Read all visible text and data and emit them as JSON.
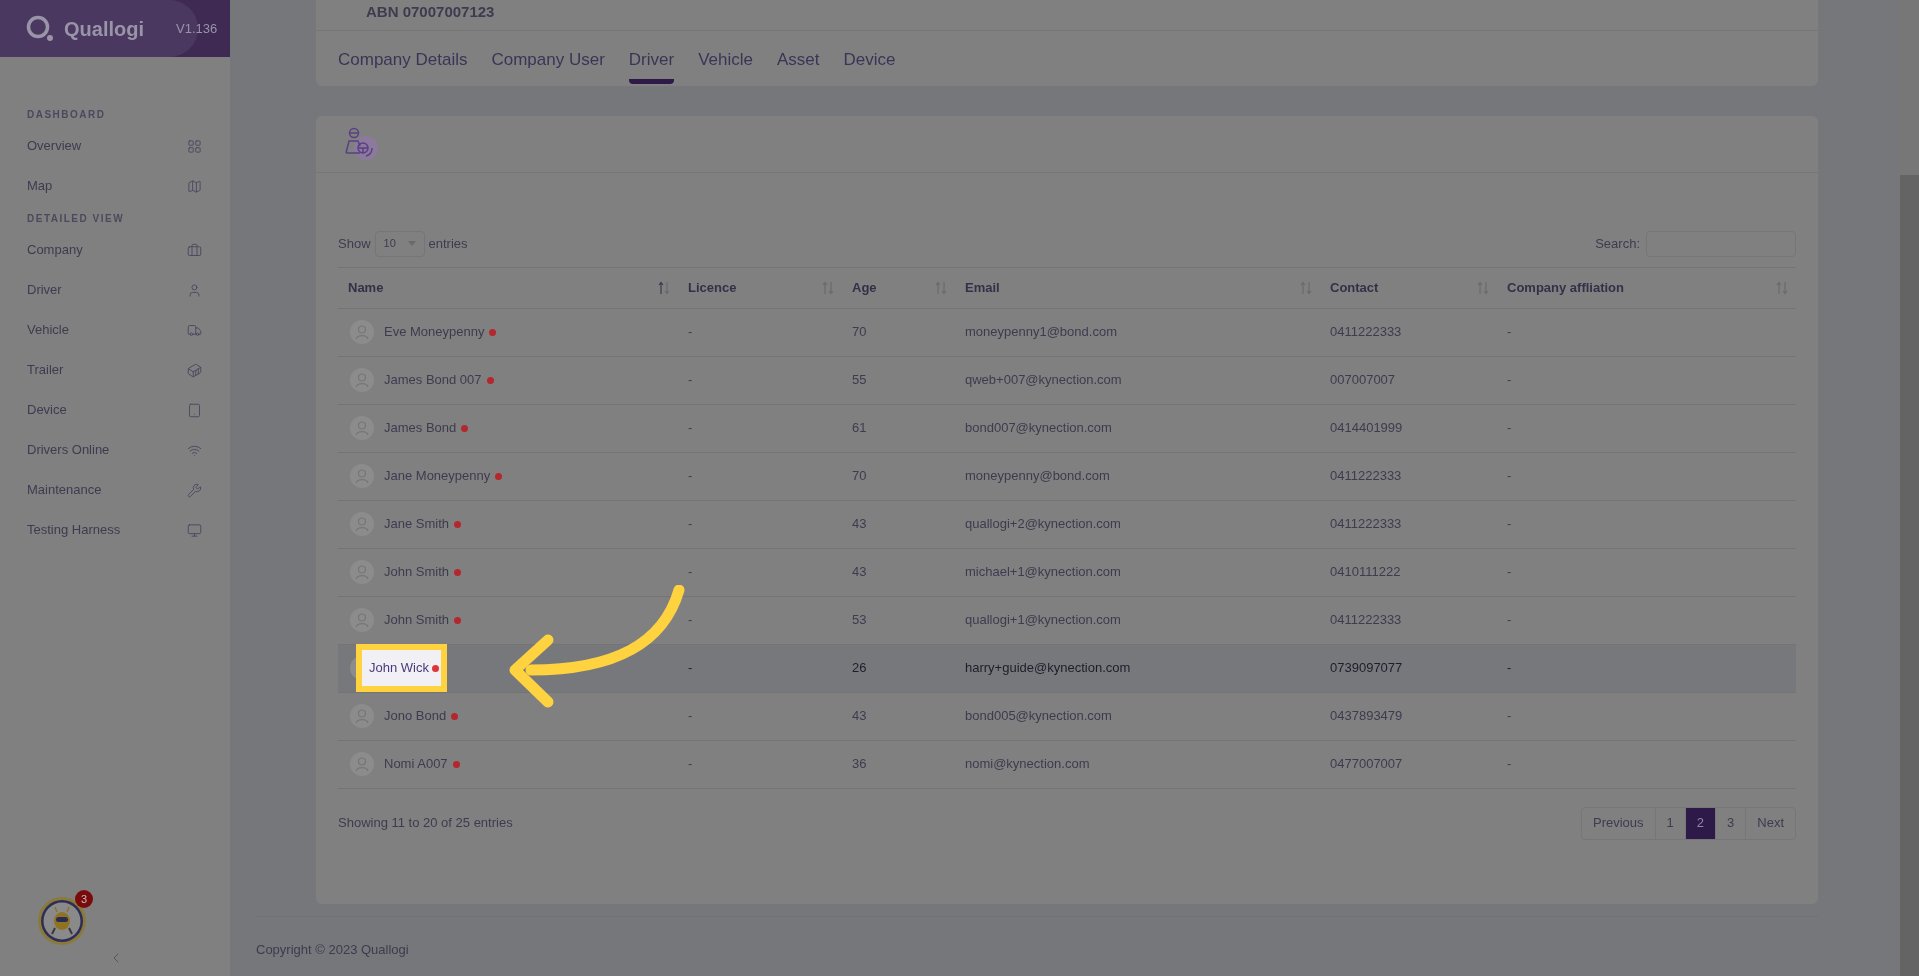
{
  "brand": {
    "name": "Quallogi",
    "version": "V1.136"
  },
  "sidebar": {
    "sections": [
      {
        "heading": "DASHBOARD",
        "items": [
          {
            "label": "Overview"
          },
          {
            "label": "Map"
          }
        ]
      },
      {
        "heading": "DETAILED VIEW",
        "items": [
          {
            "label": "Company"
          },
          {
            "label": "Driver"
          },
          {
            "label": "Vehicle"
          },
          {
            "label": "Trailer"
          },
          {
            "label": "Device"
          },
          {
            "label": "Drivers Online"
          },
          {
            "label": "Maintenance"
          },
          {
            "label": "Testing Harness"
          }
        ]
      }
    ],
    "notification_count": "3"
  },
  "company": {
    "abn": "ABN 07007007123"
  },
  "tabs": [
    {
      "label": "Company Details",
      "selected": false
    },
    {
      "label": "Company User",
      "selected": false
    },
    {
      "label": "Driver",
      "selected": true
    },
    {
      "label": "Vehicle",
      "selected": false
    },
    {
      "label": "Asset",
      "selected": false
    },
    {
      "label": "Device",
      "selected": false
    }
  ],
  "table_controls": {
    "show_label": "Show",
    "page_size": "10",
    "entries_label": "entries",
    "search_label": "Search:"
  },
  "table": {
    "columns": [
      {
        "label": "Name",
        "sorted": true
      },
      {
        "label": "Licence",
        "sorted": false
      },
      {
        "label": "Age",
        "sorted": false
      },
      {
        "label": "Email",
        "sorted": false
      },
      {
        "label": "Contact",
        "sorted": false
      },
      {
        "label": "Company affliation",
        "sorted": false
      }
    ],
    "rows": [
      {
        "name": "Eve Moneypenny",
        "color": "#b3272d",
        "licence": "-",
        "age": "70",
        "email": "moneypenny1@bond.com",
        "contact": "0411222333",
        "company": "-",
        "selected": false
      },
      {
        "name": "James Bond 007",
        "color": "#b3272d",
        "licence": "-",
        "age": "55",
        "email": "qweb+007@kynection.com",
        "contact": "007007007",
        "company": "-",
        "selected": false
      },
      {
        "name": "James Bond",
        "color": "#b3272d",
        "licence": "-",
        "age": "61",
        "email": "bond007@kynection.com",
        "contact": "0414401999",
        "company": "-",
        "selected": false
      },
      {
        "name": "Jane Moneypenny",
        "color": "#b3272d",
        "licence": "-",
        "age": "70",
        "email": "moneypenny@bond.com",
        "contact": "0411222333",
        "company": "-",
        "selected": false
      },
      {
        "name": "Jane Smith",
        "color": "#b3272d",
        "licence": "-",
        "age": "43",
        "email": "quallogi+2@kynection.com",
        "contact": "0411222333",
        "company": "-",
        "selected": false
      },
      {
        "name": "John Smith",
        "color": "#b3272d",
        "licence": "-",
        "age": "43",
        "email": "michael+1@kynection.com",
        "contact": "0410111222",
        "company": "-",
        "selected": false
      },
      {
        "name": "John Smith",
        "color": "#b3272d",
        "licence": "-",
        "age": "53",
        "email": "quallogi+1@kynection.com",
        "contact": "0411222333",
        "company": "-",
        "selected": false
      },
      {
        "name": "John Wick",
        "color": "#e0343b",
        "licence": "-",
        "age": "26",
        "email": "harry+guide@kynection.com",
        "contact": "0739097077",
        "company": "-",
        "selected": true
      },
      {
        "name": "Jono Bond",
        "color": "#b3272d",
        "licence": "-",
        "age": "43",
        "email": "bond005@kynection.com",
        "contact": "0437893479",
        "company": "-",
        "selected": false
      },
      {
        "name": "Nomi A007",
        "color": "#b3272d",
        "licence": "-",
        "age": "36",
        "email": "nomi@kynection.com",
        "contact": "0477007007",
        "company": "-",
        "selected": false
      }
    ]
  },
  "table_info": "Showing 11 to 20 of 25 entries",
  "pagination": [
    {
      "label": "Previous",
      "selected": false
    },
    {
      "label": "1",
      "selected": false
    },
    {
      "label": "2",
      "selected": true
    },
    {
      "label": "3",
      "selected": false
    },
    {
      "label": "Next",
      "selected": false
    }
  ],
  "footer": {
    "copyright": "Copyright © 2023 Quallogi"
  }
}
